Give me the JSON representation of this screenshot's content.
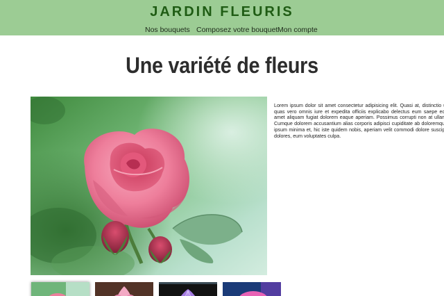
{
  "header": {
    "brand": "JARDIN FLEURIS",
    "nav": [
      {
        "label": "Nos bouquets"
      },
      {
        "label": "Composez votre bouquet"
      },
      {
        "label": "Mon compte"
      }
    ]
  },
  "main": {
    "title": "Une variété de fleurs",
    "description": "Lorem ipsum dolor sit amet consectetur adipisicing elit. Quasi at, distinctio ut quas vero omnis iure et expedita officiis explicabo delectus eum saepe eos amet aliquam fugiat dolorem eaque aperiam. Possimus corrupti non at ullam. Cumque dolorem accusantium alias corporis adipisci cupiditate ab doloremque ipsum minima et, hic iste quidem nobis, aperiam velit commodi dolore suscipit dolores, eum voluptates culpa.",
    "main_image": "pink-rose-photo",
    "thumbnails": [
      {
        "image": "pink-rose-thumbnail",
        "selected": true
      },
      {
        "image": "pink-lotus-thumbnail",
        "selected": false
      },
      {
        "image": "purple-flower-thumbnail",
        "selected": false
      },
      {
        "image": "pink-daisy-thumbnail",
        "selected": false
      }
    ]
  },
  "colors": {
    "header_background": "#9ccc94",
    "brand_text": "#1f5c14",
    "title_text": "#2d2d2d"
  }
}
